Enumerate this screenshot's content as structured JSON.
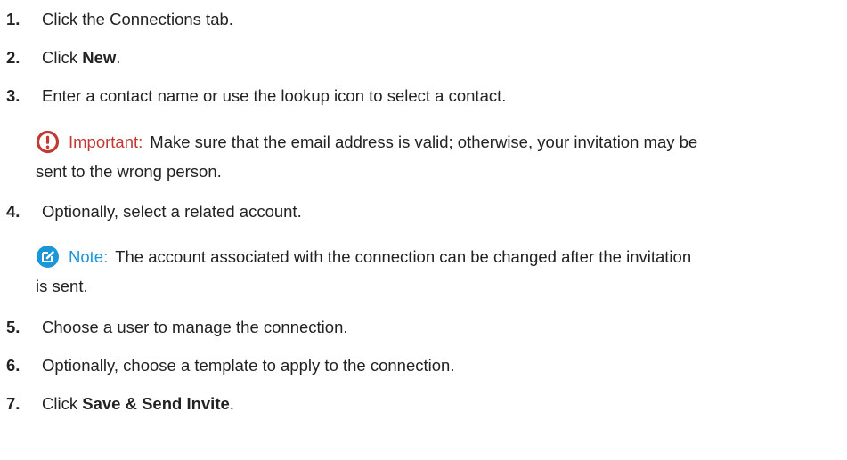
{
  "steps": [
    {
      "num": "1.",
      "pre": "Click the Connections tab.",
      "bold": "",
      "post": ""
    },
    {
      "num": "2.",
      "pre": "Click ",
      "bold": "New",
      "post": "."
    },
    {
      "num": "3.",
      "pre": "Enter a contact name or use the lookup icon to select a contact.",
      "bold": "",
      "post": ""
    },
    {
      "num": "4.",
      "pre": "Optionally, select a related account.",
      "bold": "",
      "post": ""
    },
    {
      "num": "5.",
      "pre": "Choose a user to manage the connection.",
      "bold": "",
      "post": ""
    },
    {
      "num": "6.",
      "pre": "Optionally, choose a template to apply to the connection.",
      "bold": "",
      "post": ""
    },
    {
      "num": "7.",
      "pre": "Click ",
      "bold": "Save & Send Invite",
      "post": "."
    }
  ],
  "important": {
    "icon": "exclamation-circle-icon",
    "label": "Important:",
    "line1": "Make sure that the email address is valid; otherwise, your invitation may be",
    "line2": "sent to the wrong person.",
    "color": "#c23934"
  },
  "note": {
    "icon": "edit-note-icon",
    "label": "Note:",
    "line1": "The account associated with the connection can be changed after the invitation",
    "line2": "is sent.",
    "color": "#1b96d8"
  }
}
